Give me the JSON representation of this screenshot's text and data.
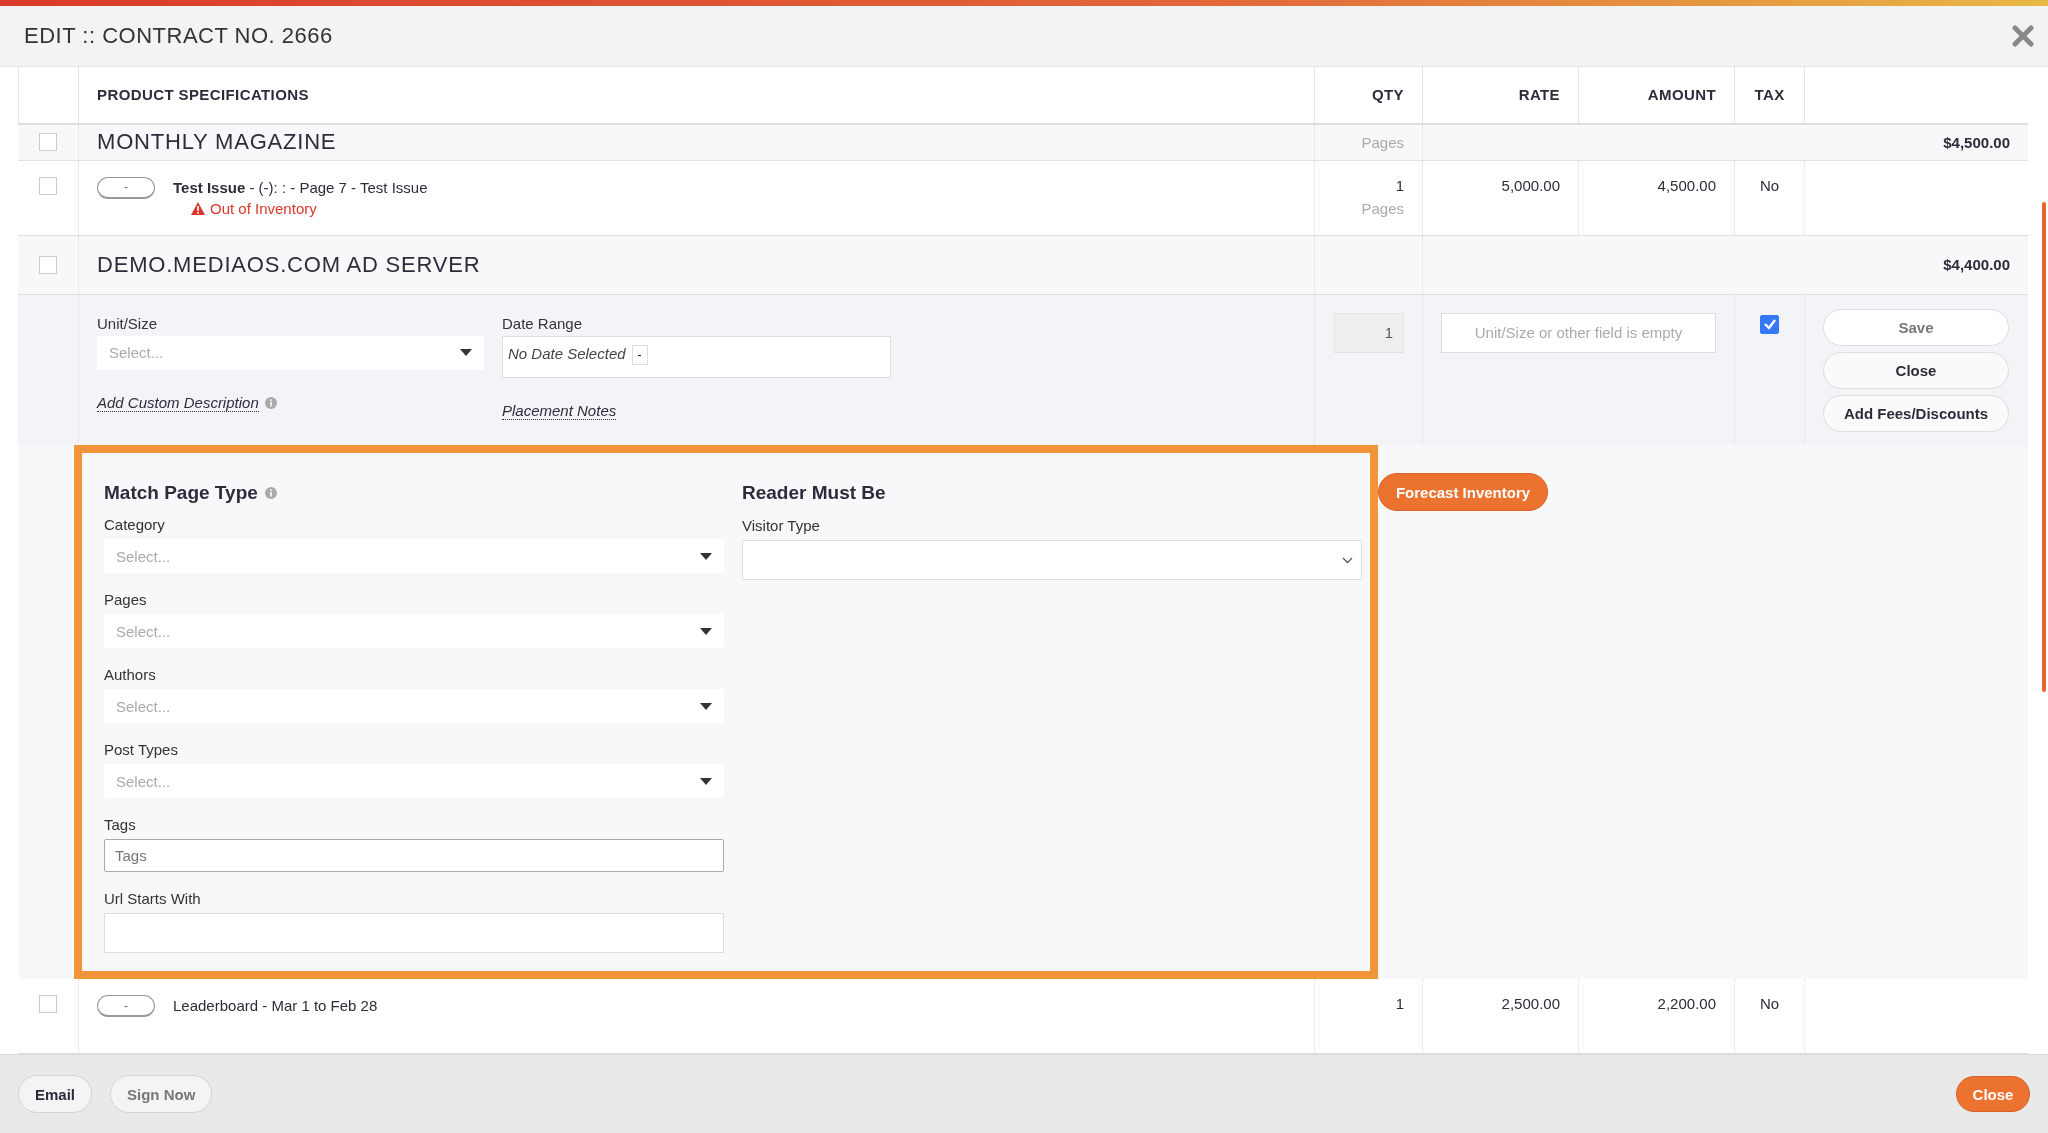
{
  "window": {
    "title": "EDIT :: CONTRACT NO. 2666"
  },
  "columns": [
    "PRODUCT SPECIFICATIONS",
    "QTY",
    "RATE",
    "AMOUNT",
    "TAX"
  ],
  "rows": [
    {
      "kind": "group",
      "checked": false,
      "name": "MONTHLY MAGAZINE",
      "qty_unit": "Pages",
      "total": "$4,500.00"
    },
    {
      "kind": "item",
      "checked": false,
      "toggle": "-",
      "bold_name": true,
      "name": "Test Issue",
      "detail": " - (-): : - Page 7 - Test Issue",
      "warning": "Out of Inventory",
      "qty": "1",
      "qty_unit": "Pages",
      "rate": "5,000.00",
      "amount": "4,500.00",
      "tax": "No"
    },
    {
      "kind": "group",
      "checked": false,
      "name": "DEMO.MEDIAOS.COM AD SERVER",
      "total": "$4,400.00"
    },
    {
      "kind": "editor",
      "unit_label": "Unit/Size",
      "unit_placeholder": "Select...",
      "date_label": "Date Range",
      "date_value": "No Date Selected",
      "date_clear": "-",
      "description_link": "Add Custom Description",
      "notes_link": "Placement Notes",
      "quantity_field": "1",
      "rate_placeholder": "Unit/Size or other field is empty",
      "tax_checked": true,
      "buttons": [
        {
          "label": "Save",
          "disabled": true
        },
        {
          "label": "Close",
          "disabled": false
        },
        {
          "label": "Add Fees/Discounts",
          "disabled": false
        }
      ]
    },
    {
      "kind": "targeting",
      "left_title": "Match Page Type",
      "right_title": "Reader Must Be",
      "forecast_button": "Forecast Inventory",
      "left_fields": [
        {
          "kind": "select",
          "label": "Category",
          "placeholder": "Select..."
        },
        {
          "kind": "select",
          "label": "Pages",
          "placeholder": "Select..."
        },
        {
          "kind": "select",
          "label": "Authors",
          "placeholder": "Select..."
        },
        {
          "kind": "select",
          "label": "Post Types",
          "placeholder": "Select..."
        },
        {
          "kind": "text",
          "label": "Tags",
          "placeholder": "Tags"
        },
        {
          "kind": "plain",
          "label": "Url Starts With"
        }
      ],
      "right_fields": [
        {
          "kind": "native",
          "label": "Visitor Type"
        }
      ]
    },
    {
      "kind": "item",
      "checked": false,
      "toggle": "-",
      "bold_name": false,
      "name": "Leaderboard - Mar 1 to Feb 28",
      "qty": "1",
      "rate": "2,500.00",
      "amount": "2,200.00",
      "tax": "No"
    }
  ],
  "footer": {
    "left_buttons": [
      {
        "label": "Email",
        "disabled": false
      },
      {
        "label": "Sign Now",
        "disabled": true
      }
    ],
    "close_button": "Close"
  }
}
